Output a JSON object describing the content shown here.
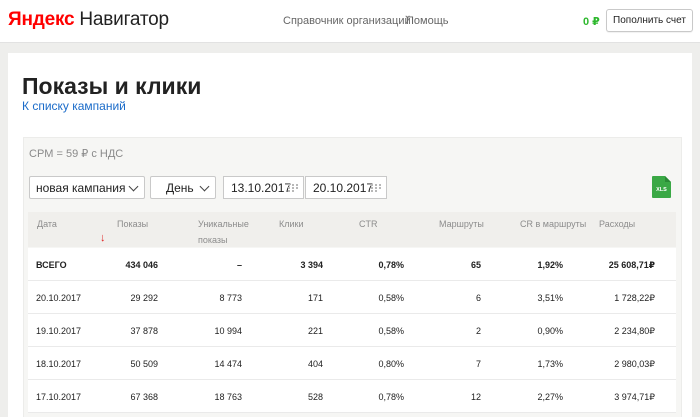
{
  "header": {
    "logo_brand": "Яндекс",
    "logo_product": "Навигатор",
    "nav": [
      "Справочник организаций",
      "Помощь"
    ],
    "balance": "0 ₽",
    "topup_label": "Пополнить счет"
  },
  "page": {
    "title": "Показы и клики",
    "back_link": "К списку кампаний",
    "cpm": "CPM = 59 ₽ с НДС"
  },
  "filters": {
    "campaign": "новая кампания",
    "period": "День",
    "date_from": "13.10.2017",
    "date_to": "20.10.2017",
    "export_label": "XLS"
  },
  "table": {
    "columns": [
      [
        "Дата"
      ],
      [
        "Показы"
      ],
      [
        "Уникальные",
        "показы"
      ],
      [
        "Клики"
      ],
      [
        "CTR"
      ],
      [
        "Маршруты"
      ],
      [
        "CR в маршруты"
      ],
      [
        "Расходы"
      ]
    ],
    "total": [
      "ВСЕГО",
      "434 046",
      "–",
      "3 394",
      "0,78%",
      "65",
      "1,92%",
      "25 608,71₽"
    ],
    "rows": [
      [
        "20.10.2017",
        "29 292",
        "8 773",
        "171",
        "0,58%",
        "6",
        "3,51%",
        "1 728,22₽"
      ],
      [
        "19.10.2017",
        "37 878",
        "10 994",
        "221",
        "0,58%",
        "2",
        "0,90%",
        "2 234,80₽"
      ],
      [
        "18.10.2017",
        "50 509",
        "14 474",
        "404",
        "0,80%",
        "7",
        "1,73%",
        "2 980,03₽"
      ],
      [
        "17.10.2017",
        "67 368",
        "18 763",
        "528",
        "0,78%",
        "12",
        "2,27%",
        "3 974,71₽"
      ]
    ]
  },
  "colors": {
    "accent_link": "#1a6bc9",
    "balance_green": "#2eb82e",
    "logo_red": "#ff0000",
    "sort_arrow": "#e02020",
    "xls_green": "#3aa845"
  }
}
